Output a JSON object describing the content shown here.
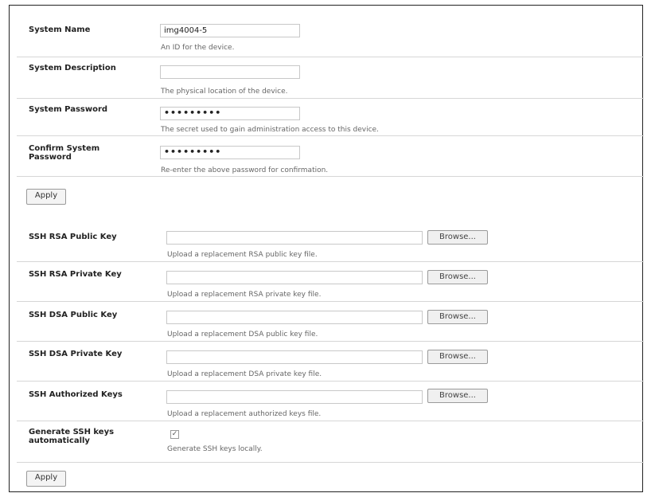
{
  "system": {
    "name": {
      "label": "System Name",
      "value": "img4004-5",
      "hint": "An ID for the device."
    },
    "description": {
      "label": "System Description",
      "value": "",
      "hint": "The physical location of the device."
    },
    "password": {
      "label": "System Password",
      "value": "•••••••••",
      "hint": "The secret used to gain administration access to this device."
    },
    "confirm": {
      "label": "Confirm System Password",
      "value": "•••••••••",
      "hint": "Re-enter the above password for confirmation."
    },
    "apply_label": "Apply"
  },
  "ssh": {
    "rsa_public": {
      "label": "SSH RSA Public Key",
      "hint": "Upload a replacement RSA public key file."
    },
    "rsa_private": {
      "label": "SSH RSA Private Key",
      "hint": "Upload a replacement RSA private key file."
    },
    "dsa_public": {
      "label": "SSH DSA Public Key",
      "hint": "Upload a replacement DSA public key file."
    },
    "dsa_private": {
      "label": "SSH DSA Private Key",
      "hint": "Upload a replacement DSA private key file."
    },
    "authorized": {
      "label": "SSH Authorized Keys",
      "hint": "Upload a replacement authorized keys file."
    },
    "browse_label": "Browse...",
    "generate": {
      "label": "Generate SSH keys automatically",
      "hint": "Generate SSH keys locally.",
      "checked": "✓"
    },
    "apply_label": "Apply"
  }
}
